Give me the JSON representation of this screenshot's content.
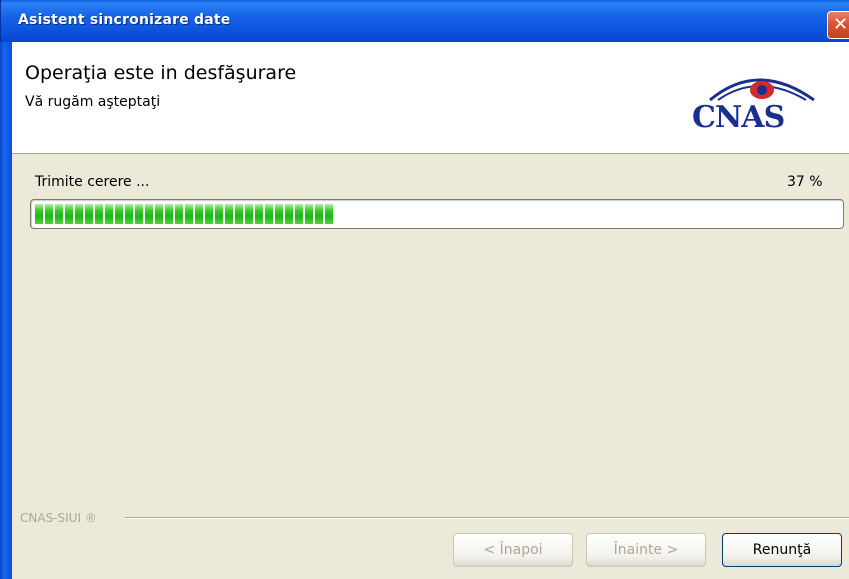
{
  "window": {
    "title": "Asistent sincronizare date",
    "close_symbol": "✕"
  },
  "header": {
    "title": "Operaţia este in desfăşurare",
    "subtitle": "Vă rugăm aşteptaţi",
    "logo_text": "CNAS"
  },
  "progress": {
    "status_text": "Trimite cerere ...",
    "percent_text": "37 %",
    "value_percent": 37
  },
  "footer": {
    "brand": "CNAS-SIUI ®",
    "back_label": "< Înapoi",
    "next_label": "Înainte >",
    "cancel_label": "Renunţă"
  },
  "colors": {
    "titlebar": "#0A4FD8",
    "progress_green": "#1CB614",
    "logo_blue": "#1B2F8F",
    "logo_red": "#D12A2A"
  }
}
